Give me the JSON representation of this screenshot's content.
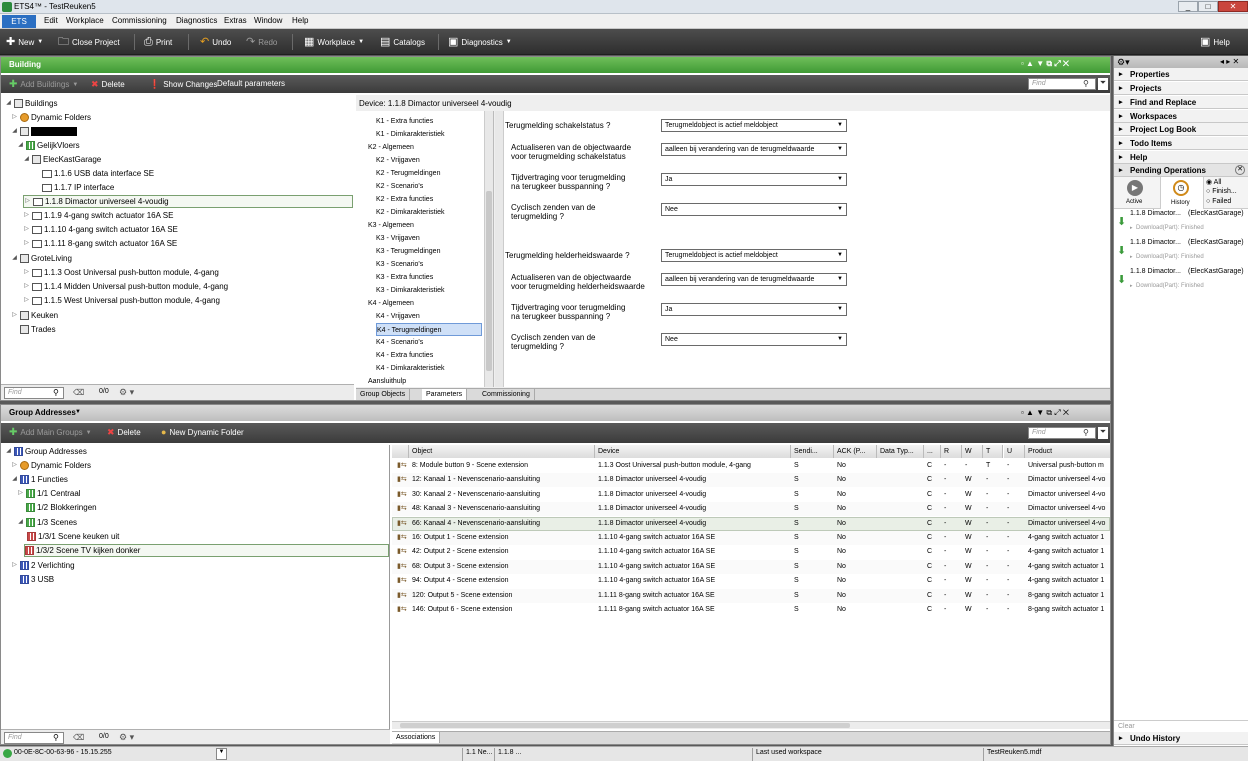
{
  "window": {
    "title": "ETS4™ - TestReuken5",
    "min": "_",
    "max": "□",
    "close": "✕"
  },
  "menu": {
    "app_button": "ETS",
    "items": [
      "Edit",
      "Workplace",
      "Commissioning",
      "Diagnostics",
      "Extras",
      "Window",
      "Help"
    ]
  },
  "toolbar": {
    "new": "New",
    "close_project": "Close Project",
    "print": "Print",
    "undo": "Undo",
    "redo": "Redo",
    "workplace": "Workplace",
    "catalogs": "Catalogs",
    "diagnostics": "Diagnostics",
    "help": "Help"
  },
  "building": {
    "title": "Building",
    "add_buildings": "Add Buildings",
    "delete": "Delete",
    "show_changes": "Show Changes",
    "default_parameters": "Default parameters",
    "find_placeholder": "Find",
    "tree": [
      {
        "label": "Buildings",
        "icon": "building-icon"
      },
      {
        "label": "Dynamic Folders",
        "icon": "dynamic-folder-icon"
      },
      {
        "label": "",
        "icon": "building-icon"
      },
      {
        "label": "GelijkVloers",
        "icon": "floor-icon"
      },
      {
        "label": "ElecKastGarage",
        "icon": "room-icon"
      },
      {
        "label": "1.1.6  USB data interface SE",
        "icon": "device-icon"
      },
      {
        "label": "1.1.7  IP interface",
        "icon": "device-icon"
      },
      {
        "label": "1.1.8  Dimactor universeel 4-voudig",
        "icon": "device-icon"
      },
      {
        "label": "1.1.9  4-gang switch actuator 16A SE",
        "icon": "device-icon"
      },
      {
        "label": "1.1.10  4-gang switch actuator 16A SE",
        "icon": "device-icon"
      },
      {
        "label": "1.1.11  8-gang switch actuator 16A SE",
        "icon": "device-icon"
      },
      {
        "label": "GroteLiving",
        "icon": "room-icon"
      },
      {
        "label": "1.1.3  Oost Universal push-button module, 4-gang",
        "icon": "device-icon"
      },
      {
        "label": "1.1.4  Midden Universal push-button module, 4-gang",
        "icon": "device-icon"
      },
      {
        "label": "1.1.5  West Universal push-button module, 4-gang",
        "icon": "device-icon"
      },
      {
        "label": "Keuken",
        "icon": "room-icon"
      },
      {
        "label": "Trades",
        "icon": "trades-icon"
      }
    ],
    "count": "0/0"
  },
  "device": {
    "header": "Device: 1.1.8  Dimactor universeel 4-voudig",
    "param_pages": [
      "K1 - Extra functies",
      "K1 - Dimkarakteristiek",
      "K2 - Algemeen",
      "K2 - Vrijgaven",
      "K2 - Terugmeldingen",
      "K2 - Scenario's",
      "K2 - Extra functies",
      "K2 - Dimkarakteristiek",
      "K3 - Algemeen",
      "K3 - Vrijgaven",
      "K3 - Terugmeldingen",
      "K3 - Scenario's",
      "K3 - Extra functies",
      "K3 - Dimkarakteristiek",
      "K4 - Algemeen",
      "K4 - Vrijgaven",
      "K4 - Terugmeldingen",
      "K4 - Scenario's",
      "K4 - Extra functies",
      "K4 - Dimkarakteristiek",
      "Aansluithulp"
    ],
    "params": [
      {
        "label": "Terugmelding schakelstatus ?",
        "value": "Terugmeldobject is actief meldobject"
      },
      {
        "label": "Actualiseren van de objectwaarde\nvoor terugmelding schakelstatus",
        "value": "aalleen bij verandering van de terugmeldwaarde"
      },
      {
        "label": "Tijdvertraging voor terugmelding\nna terugkeer busspanning ?",
        "value": "Ja"
      },
      {
        "label": "Cyclisch zenden van de\nterugmelding ?",
        "value": "Nee"
      },
      {
        "label": "Terugmelding helderheidswaarde ?",
        "value": "Terugmeldobject is actief meldobject"
      },
      {
        "label": "Actualiseren van de objectwaarde\nvoor terugmelding helderheidswaarde",
        "value": "aalleen bij verandering van de terugmeldwaarde"
      },
      {
        "label": "Tijdvertraging voor terugmelding\nna terugkeer busspanning ?",
        "value": "Ja"
      },
      {
        "label": "Cyclisch zenden van de\nterugmelding ?",
        "value": "Nee"
      }
    ],
    "tabs": [
      "Group Objects",
      "Parameters",
      "Commissioning"
    ]
  },
  "ga": {
    "title": "Group Addresses",
    "add_main_groups": "Add Main Groups",
    "delete": "Delete",
    "new_dynamic_folder": "New Dynamic Folder",
    "find_placeholder": "Find",
    "tree": [
      {
        "label": "Group Addresses"
      },
      {
        "label": "Dynamic Folders"
      },
      {
        "label": "1 Functies"
      },
      {
        "label": "1/1 Centraal"
      },
      {
        "label": "1/2 Blokkeringen"
      },
      {
        "label": "1/3 Scenes"
      },
      {
        "label": "1/3/1 Scene keuken uit"
      },
      {
        "label": "1/3/2 Scene TV kijken donker"
      },
      {
        "label": "2 Verlichting"
      },
      {
        "label": "3 USB"
      }
    ],
    "count": "0/0",
    "columns": [
      "Object",
      "Device",
      "Sendi...",
      "ACK (P...",
      "Data Typ...",
      "...",
      "R",
      "W",
      "T",
      "U",
      "Product"
    ],
    "rows": [
      [
        "8: Module button 9 - Scene extension",
        "1.1.3  Oost Universal push-button module, 4-gang",
        "S",
        "No",
        "",
        "C",
        "-",
        "-",
        "T",
        "-",
        "Universal push-button m"
      ],
      [
        "12: Kanaal 1 - Nevenscenario-aansluiting",
        "1.1.8  Dimactor universeel 4-voudig",
        "S",
        "No",
        "",
        "C",
        "-",
        "W",
        "-",
        "-",
        "Dimactor universeel 4-vo"
      ],
      [
        "30: Kanaal 2 - Nevenscenario-aansluiting",
        "1.1.8  Dimactor universeel 4-voudig",
        "S",
        "No",
        "",
        "C",
        "-",
        "W",
        "-",
        "-",
        "Dimactor universeel 4-vo"
      ],
      [
        "48: Kanaal 3 - Nevenscenario-aansluiting",
        "1.1.8  Dimactor universeel 4-voudig",
        "S",
        "No",
        "",
        "C",
        "-",
        "W",
        "-",
        "-",
        "Dimactor universeel 4-vo"
      ],
      [
        "66: Kanaal 4 - Nevenscenario-aansluiting",
        "1.1.8  Dimactor universeel 4-voudig",
        "S",
        "No",
        "",
        "C",
        "-",
        "W",
        "-",
        "-",
        "Dimactor universeel 4-vo"
      ],
      [
        "16: Output 1 - Scene extension",
        "1.1.10  4-gang switch actuator 16A SE",
        "S",
        "No",
        "",
        "C",
        "-",
        "W",
        "-",
        "-",
        "4-gang switch actuator 1"
      ],
      [
        "42: Output 2 - Scene extension",
        "1.1.10  4-gang switch actuator 16A SE",
        "S",
        "No",
        "",
        "C",
        "-",
        "W",
        "-",
        "-",
        "4-gang switch actuator 1"
      ],
      [
        "68: Output 3 - Scene extension",
        "1.1.10  4-gang switch actuator 16A SE",
        "S",
        "No",
        "",
        "C",
        "-",
        "W",
        "-",
        "-",
        "4-gang switch actuator 1"
      ],
      [
        "94: Output 4 - Scene extension",
        "1.1.10  4-gang switch actuator 16A SE",
        "S",
        "No",
        "",
        "C",
        "-",
        "W",
        "-",
        "-",
        "4-gang switch actuator 1"
      ],
      [
        "120: Output 5 - Scene extension",
        "1.1.11  8-gang switch actuator 16A SE",
        "S",
        "No",
        "",
        "C",
        "-",
        "W",
        "-",
        "-",
        "8-gang switch actuator 1"
      ],
      [
        "146: Output 6 - Scene extension",
        "1.1.11  8-gang switch actuator 16A SE",
        "S",
        "No",
        "",
        "C",
        "-",
        "W",
        "-",
        "-",
        "8-gang switch actuator 1"
      ]
    ],
    "assoc_tab": "Associations"
  },
  "right": {
    "sections": [
      "Properties",
      "Projects",
      "Find and Replace",
      "Workspaces",
      "Project Log Book",
      "Todo Items",
      "Help"
    ],
    "pending": "Pending Operations",
    "active": "Active",
    "history": "History",
    "filters": [
      "All",
      "Finish...",
      "Failed"
    ],
    "ops": [
      {
        "title": "1.1.8 Dimactor...",
        "loc": "(ElecKastGarage)",
        "status": "Download(Part): Finished"
      },
      {
        "title": "1.1.8 Dimactor...",
        "loc": "(ElecKastGarage)",
        "status": "Download(Part): Finished"
      },
      {
        "title": "1.1.8 Dimactor...",
        "loc": "(ElecKastGarage)",
        "status": "Download(Part): Finished"
      }
    ],
    "clear": "Clear",
    "undo_history": "Undo History"
  },
  "status": {
    "address": "00-0E-8C-00-63-96 - 15.15.255",
    "c1": "1.1 Ne...",
    "c2": "1.1.8 ...",
    "workspace": "Last used workspace",
    "file": "TestReuken5.mdf"
  }
}
